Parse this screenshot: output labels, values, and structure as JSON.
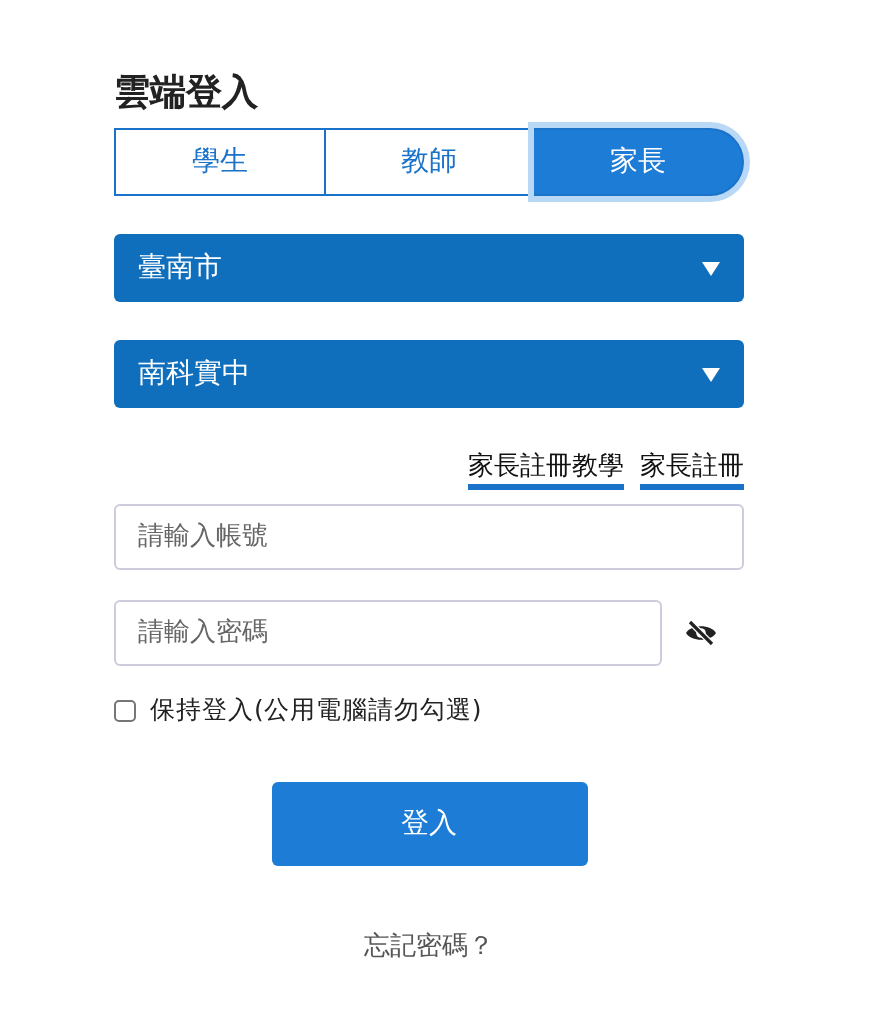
{
  "title": "雲端登入",
  "tabs": [
    {
      "label": "學生",
      "selected": false
    },
    {
      "label": "教師",
      "selected": false
    },
    {
      "label": "家長",
      "selected": true
    }
  ],
  "selects": [
    {
      "value": "臺南市"
    },
    {
      "value": "南科實中"
    }
  ],
  "links": [
    "家長註冊教學",
    "家長註冊"
  ],
  "account": {
    "placeholder": "請輸入帳號"
  },
  "password": {
    "placeholder": "請輸入密碼"
  },
  "remember": {
    "label": "保持登入(公用電腦請勿勾選)",
    "checked": false
  },
  "login_button": "登入",
  "forgot_link": "忘記密碼？"
}
